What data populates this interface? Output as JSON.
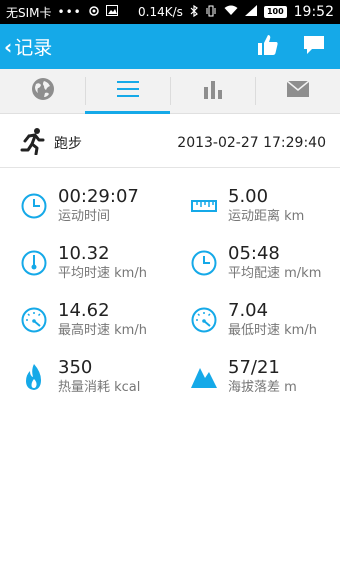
{
  "status_bar": {
    "carrier": "无SIM卡",
    "dots": "•••",
    "speed": "0.14K/s",
    "battery": "100",
    "time": "19:52"
  },
  "header": {
    "back_label": "记录",
    "icons": [
      "thumbs-up-icon",
      "chat-icon"
    ],
    "color": "#15a9e8"
  },
  "tabs": [
    {
      "icon": "globe-icon",
      "active": false
    },
    {
      "icon": "list-icon",
      "active": true
    },
    {
      "icon": "bar-chart-icon",
      "active": false
    },
    {
      "icon": "mail-icon",
      "active": false
    }
  ],
  "activity": {
    "type": "跑步",
    "datetime": "2013-02-27 17:29:40"
  },
  "stats": [
    {
      "value": "00:29:07",
      "label": "运动时间",
      "icon": "clock-icon"
    },
    {
      "value": "5.00",
      "label": "运动距离 km",
      "icon": "ruler-icon"
    },
    {
      "value": "10.32",
      "label": "平均时速 km/h",
      "icon": "thermometer-gauge-icon"
    },
    {
      "value": "05:48",
      "label": "平均配速 m/km",
      "icon": "clock-icon"
    },
    {
      "value": "14.62",
      "label": "最高时速 km/h",
      "icon": "speedometer-icon"
    },
    {
      "value": "7.04",
      "label": "最低时速 km/h",
      "icon": "speedometer-icon"
    },
    {
      "value": "350",
      "label": "热量消耗 kcal",
      "icon": "flame-icon"
    },
    {
      "value": "57/21",
      "label": "海拔落差 m",
      "icon": "mountain-icon"
    }
  ]
}
